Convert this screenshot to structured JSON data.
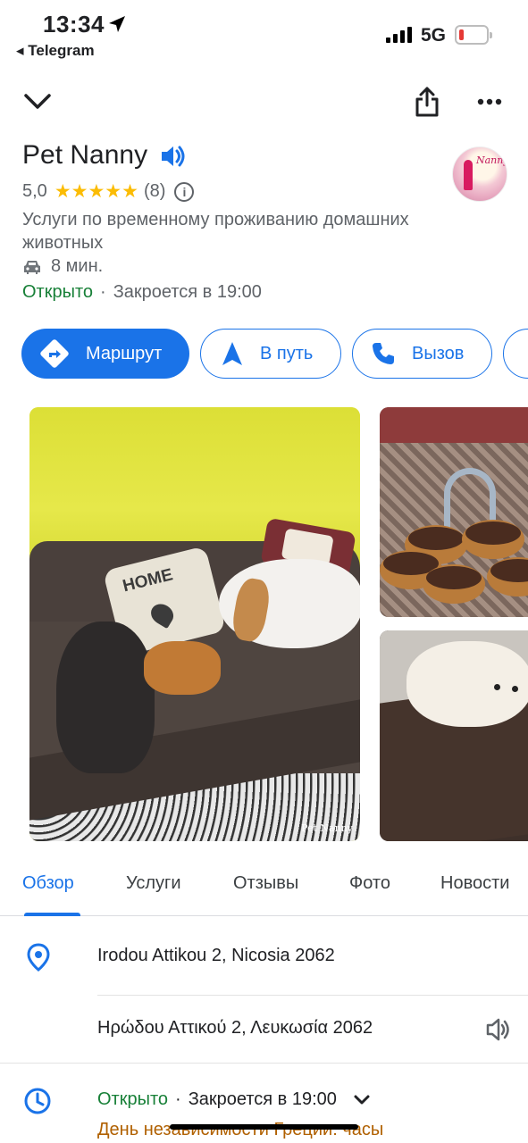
{
  "status_bar": {
    "time": "13:34",
    "back_app": "◂ Telegram",
    "network": "5G",
    "battery_level": 0.15,
    "battery_color": "#e53935"
  },
  "top_actions": {
    "collapse_icon": "chevron-down-icon",
    "share_icon": "share-icon",
    "more_icon": "more-horizontal-icon"
  },
  "place": {
    "name": "Pet Nanny",
    "rating": "5,0",
    "stars": "★★★★★",
    "review_count": "(8)",
    "category": "Услуги по временному проживанию домашних животных",
    "drive_time": "8 мин.",
    "open_status": "Открыто",
    "closes": "Закроется в 19:00",
    "avatar_text": "Nanny"
  },
  "actions": {
    "route": "Маршрут",
    "start": "В путь",
    "call": "Вызов"
  },
  "photos": {
    "main_pillow_text": "HOME",
    "main_watermark": "Pet Nanny"
  },
  "tabs": [
    {
      "label": "Обзор",
      "active": true
    },
    {
      "label": "Услуги",
      "active": false
    },
    {
      "label": "Отзывы",
      "active": false
    },
    {
      "label": "Фото",
      "active": false
    },
    {
      "label": "Новости",
      "active": false
    }
  ],
  "details": {
    "address_latin": "Irodou Attikou 2, Nicosia 2062",
    "address_greek": "Ηρώδου Αττικού 2, Λευκωσία 2062",
    "hours_open": "Открыто",
    "hours_closes": "Закроется в 19:00",
    "holiday_note": "День независимости Греции: часы"
  },
  "colors": {
    "accent": "#1a73e8",
    "open_green": "#188038",
    "star_yellow": "#fbbc04",
    "holiday_orange": "#b06000"
  }
}
